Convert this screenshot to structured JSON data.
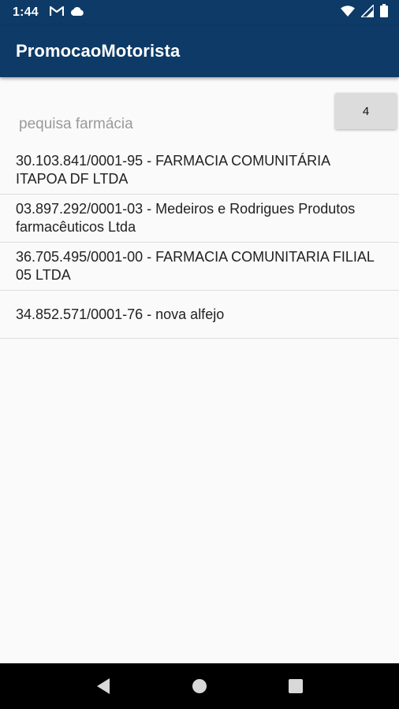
{
  "status_bar": {
    "time": "1:44",
    "icons": [
      "gmail-icon",
      "cloud-icon",
      "wifi-icon",
      "signal-icon",
      "battery-icon"
    ]
  },
  "app_bar": {
    "title": "PromocaoMotorista"
  },
  "search": {
    "placeholder": "pequisa farmácia",
    "value": ""
  },
  "count_button": {
    "label": "4"
  },
  "pharmacies": [
    {
      "text": "30.103.841/0001-95 - FARMACIA COMUNITÁRIA ITAPOA DF LTDA"
    },
    {
      "text": "03.897.292/0001-03 - Medeiros e Rodrigues Produtos farmacêuticos Ltda"
    },
    {
      "text": "36.705.495/0001-00 - FARMACIA COMUNITARIA FILIAL 05 LTDA"
    },
    {
      "text": "34.852.571/0001-76 - nova alfejo"
    }
  ],
  "nav_bar": {
    "icons": [
      "back-icon",
      "home-icon",
      "recents-icon"
    ]
  },
  "colors": {
    "primary": "#0d3a66",
    "background": "#fafafa",
    "button": "#dcdcdc"
  }
}
